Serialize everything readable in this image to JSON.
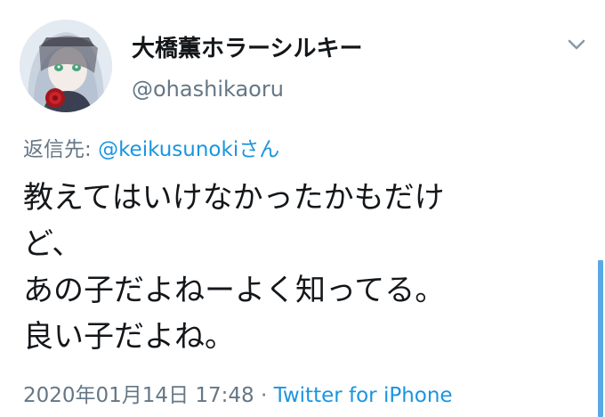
{
  "tweet": {
    "display_name": "大橋薫ホラーシルキー",
    "handle": "@ohashikaoru",
    "reply_prefix": "返信先: ",
    "reply_mention": "@keikusunoki",
    "reply_suffix": "さん",
    "text_lines": [
      "教えてはいけなかったかもだけ",
      "ど、",
      "あの子だよねーよく知ってる。",
      "良い子だよね。"
    ],
    "timestamp": "2020年01月14日 17:48",
    "separator": " · ",
    "source": "Twitter for iPhone"
  },
  "icons": {
    "avatar": "avatar-image",
    "menu": "chevron-down-icon"
  },
  "colors": {
    "link": "#1b95e0",
    "secondary_text": "#657786",
    "primary_text": "#14171a",
    "scrollbar": "#5aa9e6"
  }
}
